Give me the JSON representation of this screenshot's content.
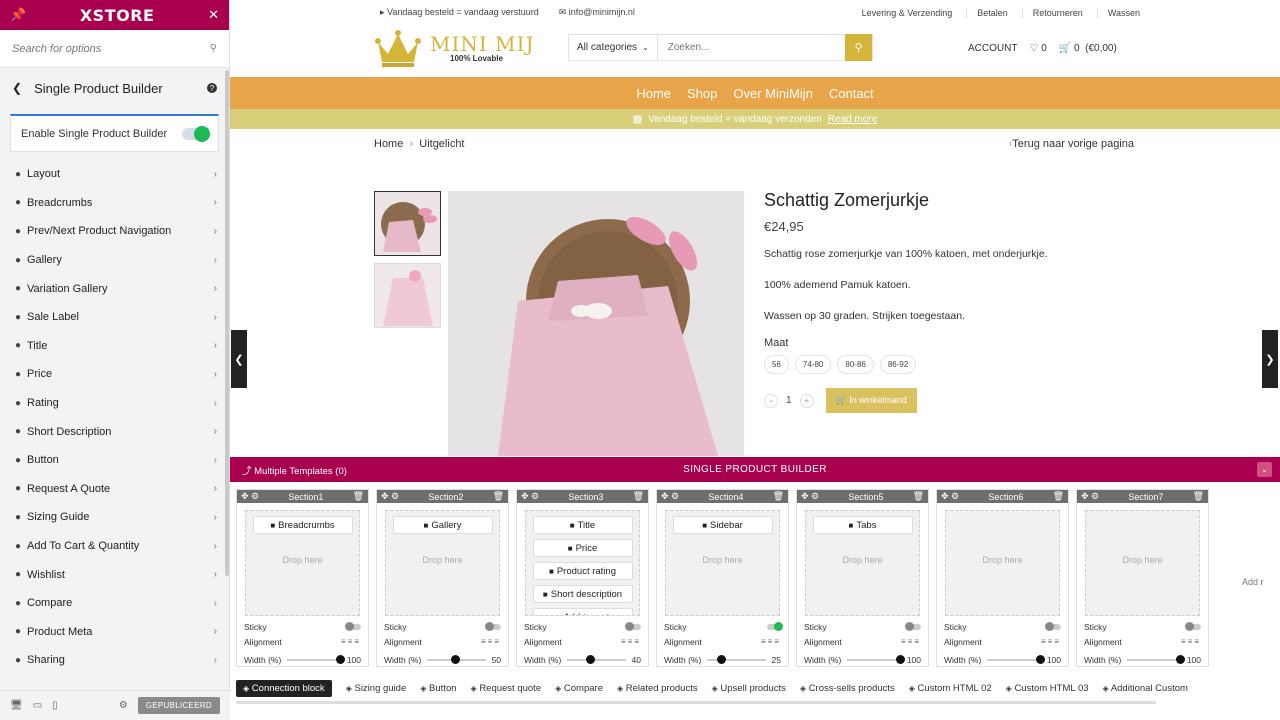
{
  "panel": {
    "logo": "XSTORE",
    "search_placeholder": "Search for options",
    "section_title": "Single Product Builder",
    "enable_label": "Enable Single Product Builder",
    "items": [
      {
        "label": "Layout",
        "icon": "list-icon"
      },
      {
        "label": "Breadcrumbs",
        "icon": "wand-icon"
      },
      {
        "label": "Prev/Next Product Navigation",
        "icon": "arrows-icon"
      },
      {
        "label": "Gallery",
        "icon": "image-icon"
      },
      {
        "label": "Variation Gallery",
        "icon": "images-icon"
      },
      {
        "label": "Sale Label",
        "icon": "tag-icon"
      },
      {
        "label": "Title",
        "icon": "text-icon"
      },
      {
        "label": "Price",
        "icon": "price-tag-icon"
      },
      {
        "label": "Rating",
        "icon": "star-icon"
      },
      {
        "label": "Short Description",
        "icon": "edit-icon"
      },
      {
        "label": "Button",
        "icon": "button-icon"
      },
      {
        "label": "Request A Quote",
        "icon": "question-icon"
      },
      {
        "label": "Sizing Guide",
        "icon": "ruler-icon"
      },
      {
        "label": "Add To Cart & Quantity",
        "icon": "cart-icon"
      },
      {
        "label": "Wishlist",
        "icon": "heart-icon"
      },
      {
        "label": "Compare",
        "icon": "compare-icon"
      },
      {
        "label": "Product Meta",
        "icon": "meta-icon"
      },
      {
        "label": "Sharing",
        "icon": "share-icon"
      }
    ],
    "publish_label": "GEPUBLICEERD"
  },
  "site": {
    "topbar": {
      "notice": "Vandaag besteld = vandaag verstuurd",
      "email": "info@minimijn.nl",
      "links": [
        "Levering & Verzending",
        "Betalen",
        "Retourneren",
        "Wassen"
      ]
    },
    "logo_text": "MINI MIJ",
    "logo_sub": "100% Lovable",
    "search": {
      "category": "All categories",
      "placeholder": "Zoeken..."
    },
    "account": "ACCOUNT",
    "wishlist_count": "0",
    "cart_count": "0",
    "cart_total": "(€0,00)",
    "nav": [
      "Home",
      "Shop",
      "Over MiniMijn",
      "Contact"
    ],
    "promo": "Vandaag besteld = vandaag verzonden",
    "promo_link": "Read more",
    "breadcrumb_home": "Home",
    "breadcrumb_current": "Uitgelicht",
    "back_link": "Terug naar vorige pagina",
    "product": {
      "title": "Schattig Zomerjurkje",
      "price": "€24,95",
      "desc1": "Schattig rose zomerjurkje van 100% katoen, met onderjurkje.",
      "desc2": "100% ademend Pamuk katoen.",
      "desc3": "Wassen op 30 graden. Strijken toegestaan.",
      "size_label": "Maat",
      "sizes": [
        "56",
        "74-80",
        "80-86",
        "86-92"
      ],
      "qty": "1",
      "add_to_cart": "In winkelmand"
    }
  },
  "builder": {
    "multi": "Multiple Templates (0)",
    "title": "SINGLE PRODUCT BUILDER",
    "drop_here": "Drop here",
    "sticky_label": "Sticky",
    "alignment_label": "Alignment",
    "width_label": "Width (%)",
    "add_label": "Add r",
    "sections": [
      {
        "name": "Section1",
        "chips": [
          "Breadcrumbs"
        ],
        "width": "100",
        "sticky": false
      },
      {
        "name": "Section2",
        "chips": [
          "Gallery"
        ],
        "width": "50",
        "sticky": false
      },
      {
        "name": "Section3",
        "chips": [
          "Title",
          "Price",
          "Product rating",
          "Short description",
          "Add to cart"
        ],
        "width": "40",
        "sticky": false
      },
      {
        "name": "Section4",
        "chips": [
          "Sidebar"
        ],
        "width": "25",
        "sticky": true
      },
      {
        "name": "Section5",
        "chips": [
          "Tabs"
        ],
        "width": "100",
        "sticky": false
      },
      {
        "name": "Section6",
        "chips": [],
        "width": "100",
        "sticky": false
      },
      {
        "name": "Section7",
        "chips": [],
        "width": "100",
        "sticky": false
      }
    ],
    "footer_items": [
      "Connection block",
      "Sizing guide",
      "Button",
      "Request quote",
      "Compare",
      "Related products",
      "Upsell products",
      "Cross-sells products",
      "Custom HTML 02",
      "Custom HTML 03",
      "Additional Custom"
    ]
  },
  "colors": {
    "brand": "#a8004f",
    "nav": "#e8a448",
    "gold": "#d4b53a",
    "toggle_on": "#1db954"
  }
}
